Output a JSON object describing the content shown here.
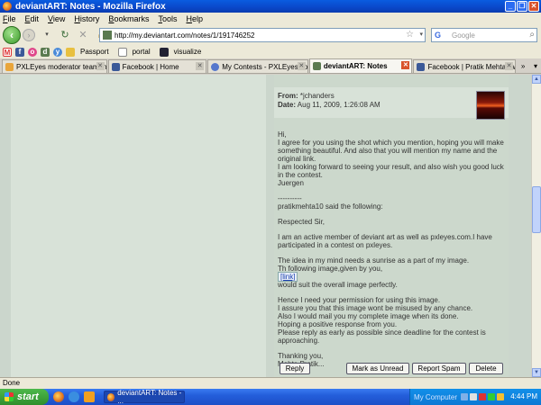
{
  "window": {
    "title": "deviantART: Notes - Mozilla Firefox"
  },
  "menu": [
    "File",
    "Edit",
    "View",
    "History",
    "Bookmarks",
    "Tools",
    "Help"
  ],
  "nav": {
    "url": "http://my.deviantart.com/notes/1/191746252",
    "search_placeholder": "Google"
  },
  "bookmarks": [
    {
      "label": "",
      "icon": "gmail-icon"
    },
    {
      "label": "",
      "icon": "facebook-icon"
    },
    {
      "label": "",
      "icon": "orkut-icon"
    },
    {
      "label": "",
      "icon": "deviantart-icon"
    },
    {
      "label": "",
      "icon": "yahoo-icon"
    },
    {
      "label": "Passport",
      "icon": "passport-icon"
    },
    {
      "label": "portal",
      "icon": "page-icon"
    },
    {
      "label": "visualize",
      "icon": "visualize-icon"
    }
  ],
  "tabs": [
    {
      "label": "PXLEyes moderator team m...",
      "active": false
    },
    {
      "label": "Facebook | Home",
      "active": false
    },
    {
      "label": "My Contests - PXLEyes.com",
      "active": false
    },
    {
      "label": "deviantART: Notes",
      "active": true
    },
    {
      "label": "Facebook | Pratik Mehta Sw...",
      "active": false
    }
  ],
  "note": {
    "from_label": "From:",
    "from_value": "*jchanders",
    "date_label": "Date:",
    "date_value": "Aug 11, 2009, 1:26:08 AM",
    "body": {
      "greeting": "Hi,",
      "p1": "I agree for you using the shot which you mention, hoping you will make something beautiful. And also that you will mention my name and the original link.",
      "p2": "I am looking forward to seeing your result, and also wish you good luck in the contest.",
      "sign1": "Juergen",
      "separator": "----------",
      "quote_head": "pratikmehta10 said the following:",
      "salutation": "Respected Sir,",
      "q1": "I am an active member of deviant art as well as pxleyes.com.I have participated in a contest on pxleyes.",
      "q2": "The idea in my mind needs a sunrise as a part of my image.",
      "q3": "Th following image,given by you,",
      "link": "[link]",
      "q4": "would suit the overall image perfectly.",
      "q5": "Hence I need your permission for using this image.",
      "q6": "I assure you that this image wont be misused by any chance.",
      "q7": "Also I would mail you my complete image when its done.",
      "q8": "Hoping a positive response from you.",
      "q9": "Please reply as early as possible since deadline for the contest is approaching.",
      "thanks": "Thanking you,",
      "sign2": "Mehta Pratik..."
    },
    "actions": {
      "reply": "Reply",
      "mark_unread": "Mark as Unread",
      "report_spam": "Report Spam",
      "delete": "Delete"
    }
  },
  "status": {
    "text": "Done"
  },
  "taskbar": {
    "start": "start",
    "task": "deviantART: Notes - ...",
    "tray_label": "My Computer",
    "clock": "4:44 PM"
  }
}
